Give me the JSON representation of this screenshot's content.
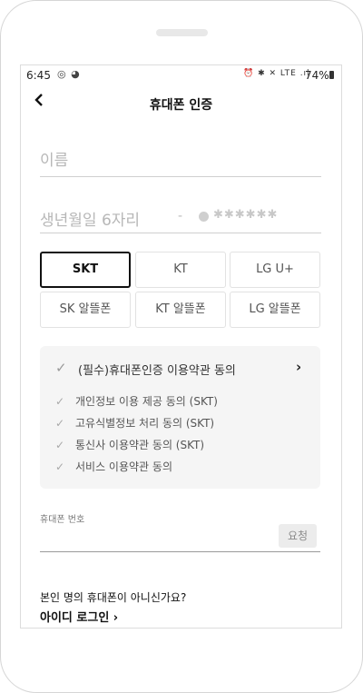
{
  "status_bar": {
    "time": "6:45",
    "left_icons": "◎ ◕",
    "right_icons": "⏰ ✱ ✕ LTE .ıl",
    "battery_percent": "74%"
  },
  "header": {
    "back_icon": "‹",
    "title": "휴대폰 인증"
  },
  "form": {
    "name_placeholder": "이름",
    "birth_placeholder": "생년월일 6자리",
    "birth_dash": "-",
    "birth_mask": "✱✱✱✱✱✱"
  },
  "carriers": [
    {
      "label": "SKT",
      "selected": true
    },
    {
      "label": "KT",
      "selected": false
    },
    {
      "label": "LG U+",
      "selected": false
    },
    {
      "label": "SK 알뜰폰",
      "selected": false
    },
    {
      "label": "KT 알뜰폰",
      "selected": false
    },
    {
      "label": "LG 알뜰폰",
      "selected": false
    }
  ],
  "terms": {
    "main_label": "(필수)휴대폰인증 이용약관 동의",
    "check_icon": "✓",
    "arrow_icon": "›",
    "items": [
      "개인정보 이용 제공 동의 (SKT)",
      "고유식별정보 처리 동의 (SKT)",
      "통신사 이용약관 동의 (SKT)",
      "서비스 이용약관 동의"
    ]
  },
  "phone": {
    "label": "휴대폰 번호",
    "request_button": "요청"
  },
  "footer": {
    "question": "본인 명의 휴대폰이 아니신가요?",
    "id_login": "아이디 로그인 ›"
  },
  "colors": {
    "selected_border": "#111111",
    "terms_bg": "#f5f5f5",
    "placeholder": "#b7b7b7"
  }
}
